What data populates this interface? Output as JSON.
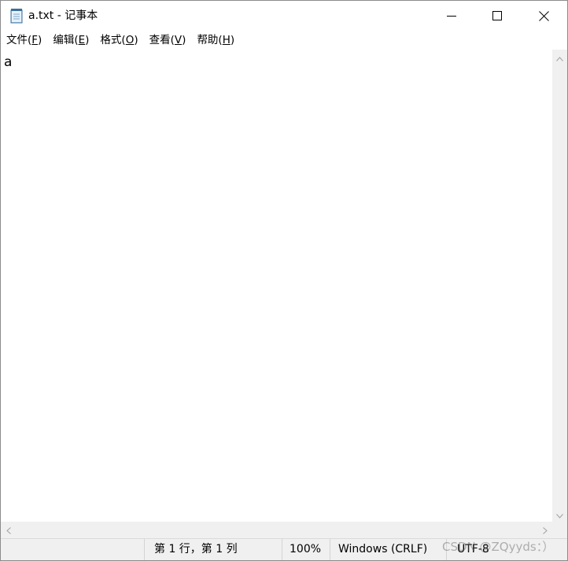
{
  "window": {
    "title": "a.txt - 记事本",
    "icons": {
      "app": "notepad-icon",
      "minimize": "minimize-icon",
      "maximize": "maximize-icon",
      "close": "close-icon"
    }
  },
  "menubar": {
    "items": [
      {
        "label": "文件(",
        "accel": "F",
        "suffix": ")"
      },
      {
        "label": "编辑(",
        "accel": "E",
        "suffix": ")"
      },
      {
        "label": "格式(",
        "accel": "O",
        "suffix": ")"
      },
      {
        "label": "查看(",
        "accel": "V",
        "suffix": ")"
      },
      {
        "label": "帮助(",
        "accel": "H",
        "suffix": ")"
      }
    ]
  },
  "editor": {
    "content": "a"
  },
  "scrollbars": {
    "icons": {
      "up": "chevron-up-icon",
      "down": "chevron-down-icon",
      "left": "chevron-left-icon",
      "right": "chevron-right-icon"
    }
  },
  "statusbar": {
    "position": "第 1 行，第 1 列",
    "zoom": "100%",
    "line_ending": "Windows (CRLF)",
    "encoding": "UTF-8"
  },
  "watermark": {
    "text": "CSDN @ZQyyds：）"
  },
  "colors": {
    "window_border": "#8c8c8c",
    "scrollbar_bg": "#f0f0f0",
    "statusbar_bg": "#f0f0f0"
  }
}
